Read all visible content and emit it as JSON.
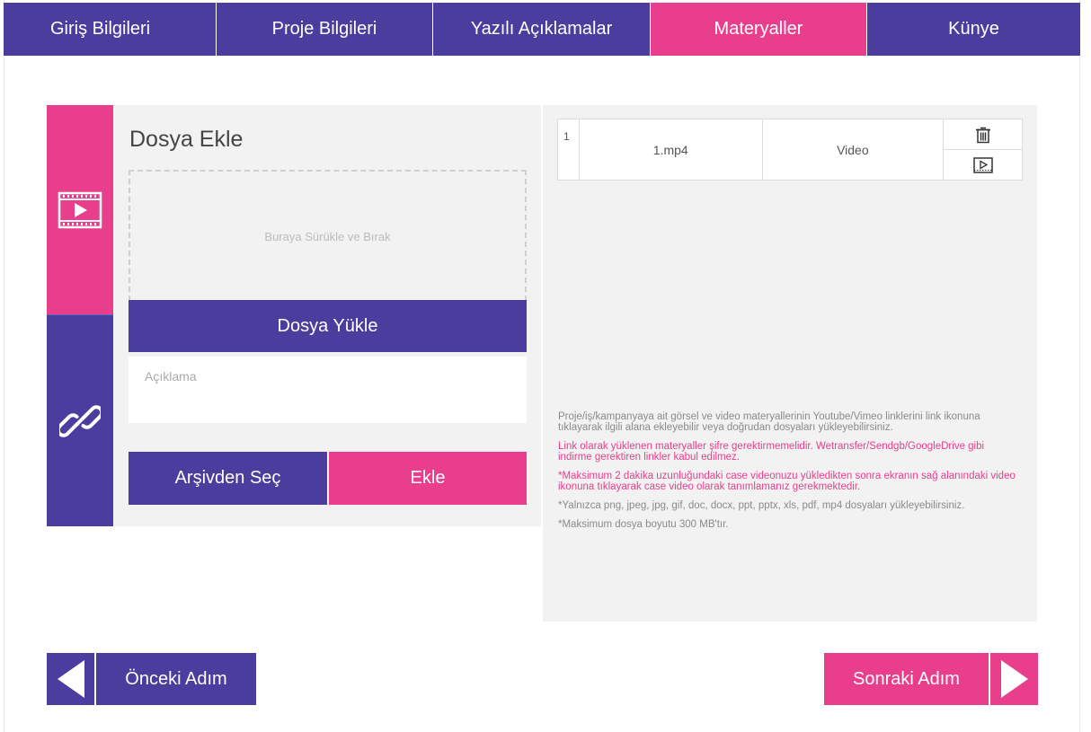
{
  "tabs": [
    {
      "label": "Giriş Bilgileri"
    },
    {
      "label": "Proje Bilgileri"
    },
    {
      "label": "Yazılı Açıklamalar"
    },
    {
      "label": "Materyaller"
    },
    {
      "label": "Künye"
    }
  ],
  "active_tab": "Materyaller",
  "side": {
    "video_icon": "video-film-icon",
    "link_icon": "chain-link-icon"
  },
  "form": {
    "title": "Dosya Ekle",
    "dropzone_text": "Buraya Sürükle ve Bırak",
    "upload_label": "Dosya Yükle",
    "description_placeholder": "Açıklama",
    "description_value": "",
    "archive_label": "Arşivden Seç",
    "add_label": "Ekle"
  },
  "files": [
    {
      "index": "1",
      "name": "1.mp4",
      "type": "Video",
      "actions": [
        "trash-icon",
        "play-video-icon"
      ]
    }
  ],
  "notes": [
    {
      "text": "Proje/iş/kampanyaya ait görsel ve video materyallerinin Youtube/Vimeo linklerini link ikonuna tıklayarak ilgili alana ekleyebilir veya doğrudan dosyaları yükleyebilirsiniz.",
      "color": "gray"
    },
    {
      "text": "Link olarak yüklenen materyaller şifre gerektirmemelidir. Wetransfer/Sendgb/GoogleDrive gibi indirme gerektiren linkler kabul edilmez.",
      "color": "pink"
    },
    {
      "text": "*Maksimum 2 dakika uzunluğundaki case videonuzu yükledikten sonra ekranın sağ alanındaki video ikonuna tıklayarak case video olarak tanımlamanız gerekmektedir.",
      "color": "pink"
    },
    {
      "text": "*Yalnızca png, jpeg, jpg, gif, doc, docx, ppt, pptx, xls, pdf, mp4 dosyaları yükleyebilirsiniz.",
      "color": "gray"
    },
    {
      "text": "*Maksimum dosya boyutu 300 MB'tır.",
      "color": "gray"
    }
  ],
  "nav": {
    "prev_label": "Önceki Adım",
    "next_label": "Sonraki Adım"
  },
  "colors": {
    "primary": "#4a3d9e",
    "accent": "#e83e8c",
    "panel": "#f2f2f2"
  }
}
